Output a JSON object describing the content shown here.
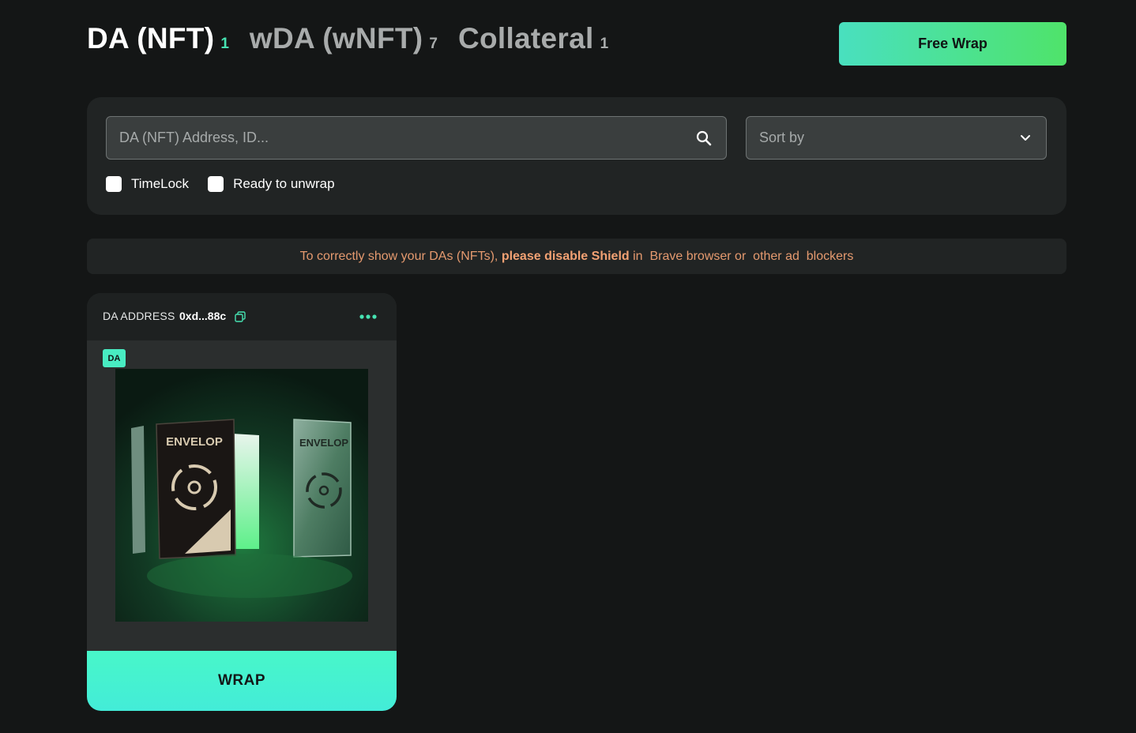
{
  "tabs": [
    {
      "label": "DA (NFT)",
      "count": "1"
    },
    {
      "label": "wDA (wNFT)",
      "count": "7"
    },
    {
      "label": "Collateral",
      "count": "1"
    }
  ],
  "actions": {
    "free_wrap_label": "Free Wrap"
  },
  "filters": {
    "search_placeholder": "DA (NFT) Address, ID...",
    "sort_label": "Sort by",
    "checkboxes": [
      {
        "label": "TimeLock",
        "checked": false
      },
      {
        "label": "Ready to unwrap",
        "checked": false
      }
    ]
  },
  "notice": {
    "prefix": "To correctly show your DAs (NFTs),",
    "bold": "please disable Shield",
    "suffix": "in  Brave browser or  other ad  blockers"
  },
  "card": {
    "address_label": "DA ADDRESS",
    "address_value": "0xd...88c",
    "badge": "DA",
    "image_texts": [
      "ENVELOP",
      "ENVELOP"
    ],
    "wrap_label": "WRAP"
  },
  "colors": {
    "accent": "#46e3b2",
    "background": "#141616",
    "panel": "#212424",
    "notice_text": "#e59a6f"
  },
  "icons": [
    "search-icon",
    "chevron-down-icon",
    "copy-icon",
    "more-dots-icon"
  ]
}
